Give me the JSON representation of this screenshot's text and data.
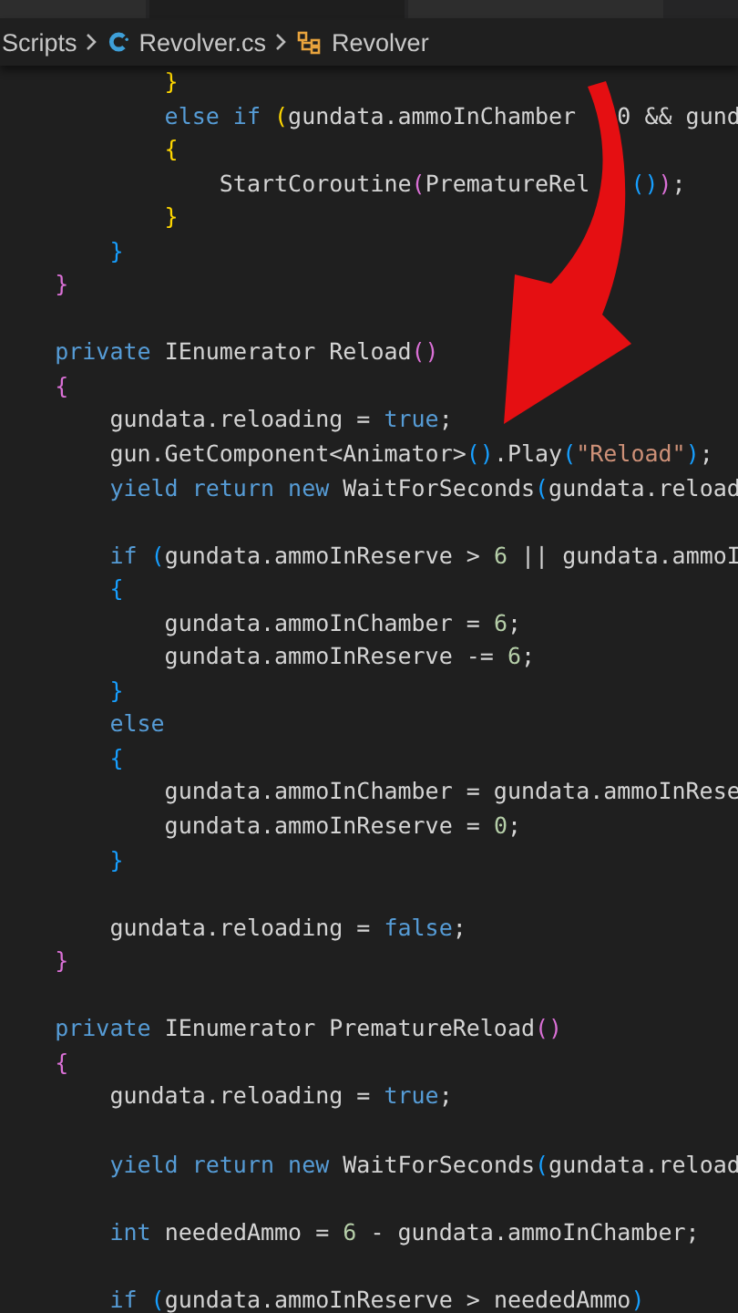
{
  "tabs": [
    {
      "selected": false
    },
    {
      "selected": true
    },
    {
      "selected": false
    }
  ],
  "breadcrumbs": [
    {
      "kind": "folder",
      "label": "Scripts"
    },
    {
      "kind": "file",
      "label": "Revolver.cs"
    },
    {
      "kind": "class",
      "label": "Revolver"
    }
  ],
  "code_lines": [
    {
      "kind": "code",
      "tokens": [
        {
          "kind": "b1",
          "text": "            }"
        }
      ]
    },
    {
      "kind": "code",
      "tokens": [
        {
          "kind": "kw",
          "text": "            else if "
        },
        {
          "kind": "b1",
          "text": "("
        },
        {
          "kind": "plain",
          "text": "gundata.ammoInChamber   0 && gund"
        }
      ]
    },
    {
      "kind": "code",
      "tokens": [
        {
          "kind": "b1",
          "text": "            {"
        }
      ]
    },
    {
      "kind": "code",
      "tokens": [
        {
          "kind": "plain",
          "text": "                StartCoroutine"
        },
        {
          "kind": "b2",
          "text": "("
        },
        {
          "kind": "plain",
          "text": "PrematureRel   "
        },
        {
          "kind": "b3",
          "text": "()"
        },
        {
          "kind": "b2",
          "text": ")"
        },
        {
          "kind": "plain",
          "text": ";"
        }
      ]
    },
    {
      "kind": "code",
      "tokens": [
        {
          "kind": "b1",
          "text": "            }"
        }
      ]
    },
    {
      "kind": "code",
      "tokens": [
        {
          "kind": "b3",
          "text": "        }"
        }
      ]
    },
    {
      "kind": "code",
      "tokens": [
        {
          "kind": "b2",
          "text": "    }"
        }
      ]
    },
    {
      "kind": "blank"
    },
    {
      "kind": "code",
      "tokens": [
        {
          "kind": "kw",
          "text": "    private "
        },
        {
          "kind": "plain",
          "text": "IEnumerator Reload"
        },
        {
          "kind": "b2",
          "text": "()"
        }
      ]
    },
    {
      "kind": "code",
      "tokens": [
        {
          "kind": "b2",
          "text": "    {"
        }
      ]
    },
    {
      "kind": "code",
      "tokens": [
        {
          "kind": "plain",
          "text": "        gundata.reloading = "
        },
        {
          "kind": "kw",
          "text": "true"
        },
        {
          "kind": "plain",
          "text": ";"
        }
      ]
    },
    {
      "kind": "code",
      "tokens": [
        {
          "kind": "plain",
          "text": "        gun.GetComponent<Animator>"
        },
        {
          "kind": "b3",
          "text": "()"
        },
        {
          "kind": "plain",
          "text": ".Play"
        },
        {
          "kind": "b3",
          "text": "("
        },
        {
          "kind": "str",
          "text": "\"Reload\""
        },
        {
          "kind": "b3",
          "text": ")"
        },
        {
          "kind": "plain",
          "text": ";"
        }
      ]
    },
    {
      "kind": "code",
      "tokens": [
        {
          "kind": "kw",
          "text": "        yield return new "
        },
        {
          "kind": "plain",
          "text": "WaitForSeconds"
        },
        {
          "kind": "b3",
          "text": "("
        },
        {
          "kind": "plain",
          "text": "gundata.reload"
        }
      ]
    },
    {
      "kind": "blank"
    },
    {
      "kind": "code",
      "tokens": [
        {
          "kind": "kw",
          "text": "        if "
        },
        {
          "kind": "b3",
          "text": "("
        },
        {
          "kind": "plain",
          "text": "gundata.ammoInReserve > "
        },
        {
          "kind": "num",
          "text": "6"
        },
        {
          "kind": "plain",
          "text": " || gundata.ammoI"
        }
      ]
    },
    {
      "kind": "code",
      "tokens": [
        {
          "kind": "b3",
          "text": "        {"
        }
      ]
    },
    {
      "kind": "code",
      "tokens": [
        {
          "kind": "plain",
          "text": "            gundata.ammoInChamber = "
        },
        {
          "kind": "num",
          "text": "6"
        },
        {
          "kind": "plain",
          "text": ";"
        }
      ]
    },
    {
      "kind": "code",
      "tokens": [
        {
          "kind": "plain",
          "text": "            gundata.ammoInReserve -= "
        },
        {
          "kind": "num",
          "text": "6"
        },
        {
          "kind": "plain",
          "text": ";"
        }
      ]
    },
    {
      "kind": "code",
      "tokens": [
        {
          "kind": "b3",
          "text": "        }"
        }
      ]
    },
    {
      "kind": "code",
      "tokens": [
        {
          "kind": "kw",
          "text": "        else"
        }
      ]
    },
    {
      "kind": "code",
      "tokens": [
        {
          "kind": "b3",
          "text": "        {"
        }
      ]
    },
    {
      "kind": "code",
      "tokens": [
        {
          "kind": "plain",
          "text": "            gundata.ammoInChamber = gundata.ammoInRese"
        }
      ]
    },
    {
      "kind": "code",
      "tokens": [
        {
          "kind": "plain",
          "text": "            gundata.ammoInReserve = "
        },
        {
          "kind": "num",
          "text": "0"
        },
        {
          "kind": "plain",
          "text": ";"
        }
      ]
    },
    {
      "kind": "code",
      "tokens": [
        {
          "kind": "b3",
          "text": "        }"
        }
      ]
    },
    {
      "kind": "blank"
    },
    {
      "kind": "code",
      "tokens": [
        {
          "kind": "plain",
          "text": "        gundata.reloading = "
        },
        {
          "kind": "kw",
          "text": "false"
        },
        {
          "kind": "plain",
          "text": ";"
        }
      ]
    },
    {
      "kind": "code",
      "tokens": [
        {
          "kind": "b2",
          "text": "    }"
        }
      ]
    },
    {
      "kind": "blank"
    },
    {
      "kind": "code",
      "tokens": [
        {
          "kind": "kw",
          "text": "    private "
        },
        {
          "kind": "plain",
          "text": "IEnumerator PrematureReload"
        },
        {
          "kind": "b2",
          "text": "()"
        }
      ]
    },
    {
      "kind": "code",
      "tokens": [
        {
          "kind": "b2",
          "text": "    {"
        }
      ]
    },
    {
      "kind": "code",
      "tokens": [
        {
          "kind": "plain",
          "text": "        gundata.reloading = "
        },
        {
          "kind": "kw",
          "text": "true"
        },
        {
          "kind": "plain",
          "text": ";"
        }
      ]
    },
    {
      "kind": "blank"
    },
    {
      "kind": "code",
      "tokens": [
        {
          "kind": "kw",
          "text": "        yield return new "
        },
        {
          "kind": "plain",
          "text": "WaitForSeconds"
        },
        {
          "kind": "b3",
          "text": "("
        },
        {
          "kind": "plain",
          "text": "gundata.reload"
        }
      ]
    },
    {
      "kind": "blank"
    },
    {
      "kind": "code",
      "tokens": [
        {
          "kind": "kw",
          "text": "        int "
        },
        {
          "kind": "plain",
          "text": "neededAmmo = "
        },
        {
          "kind": "num",
          "text": "6"
        },
        {
          "kind": "plain",
          "text": " - gundata.ammoInChamber;"
        }
      ]
    },
    {
      "kind": "blank"
    },
    {
      "kind": "code",
      "tokens": [
        {
          "kind": "kw",
          "text": "        if "
        },
        {
          "kind": "b3",
          "text": "("
        },
        {
          "kind": "plain",
          "text": "gundata.ammoInReserve > neededAmmo"
        },
        {
          "kind": "b3",
          "text": ")"
        }
      ]
    }
  ]
}
